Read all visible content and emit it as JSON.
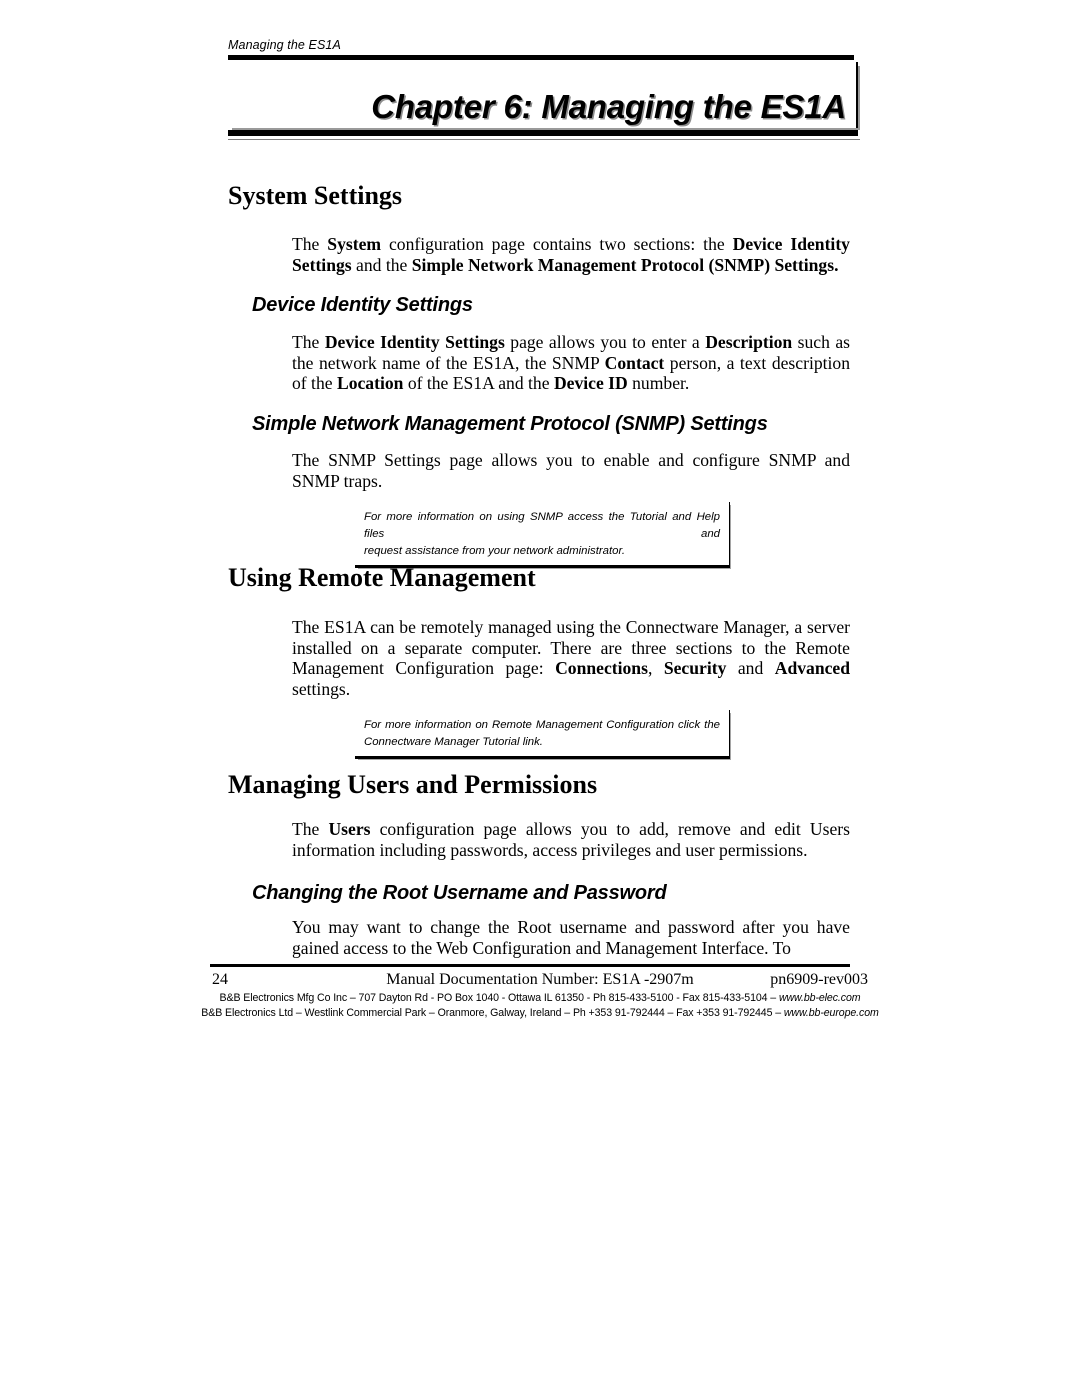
{
  "document": {
    "running_header": "Managing the ES1A",
    "chapter_title": "Chapter 6:  Managing the ES1A"
  },
  "sections": [
    {
      "heading": "System Settings",
      "paragraph_parts": [
        {
          "text": "The ",
          "bold": false
        },
        {
          "text": "System",
          "bold": true
        },
        {
          "text": " configuration page contains two sections: the ",
          "bold": false
        },
        {
          "text": "Device Identity Settings",
          "bold": true
        },
        {
          "text": " and the ",
          "bold": false
        },
        {
          "text": "Simple Network Management Protocol (SNMP) Settings.",
          "bold": true
        }
      ],
      "paragraph_plain": "The System configuration page contains two sections: the Device Identity Settings and the Simple Network Management Protocol (SNMP) Settings."
    },
    {
      "heading": "Device Identity Settings",
      "paragraph_plain": "The Device Identity Settings page allows you to enter a Description such as the network name of the ES1A, the SNMP Contact person, a text description of the Location of the ES1A and the Device ID number."
    },
    {
      "heading": "Simple Network Management Protocol (SNMP) Settings",
      "paragraph_plain": "The SNMP Settings page allows you to enable and configure SNMP and SNMP traps."
    },
    {
      "heading": "Using Remote Management",
      "paragraph_plain": "The ES1A can be remotely managed using the Connectware Manager, a server installed on a separate computer. There are three sections to the Remote Management Configuration page: Connections, Security and Advanced settings."
    },
    {
      "heading": "Managing Users and Permissions",
      "paragraph_plain": "The Users configuration page allows you to add, remove and edit Users information including passwords, access privileges and user permissions."
    },
    {
      "heading": "Changing the Root Username and Password",
      "paragraph_plain": "You may want to change the Root username and password after you have gained access to the Web Configuration and Management Interface. To"
    }
  ],
  "notes": [
    {
      "line1": "For more information on using SNMP access the Tutorial and Help files and",
      "line2": "request assistance from your network administrator."
    },
    {
      "line1": "For more information on Remote Management Configuration click the",
      "line2": "Connectware Manager Tutorial link."
    }
  ],
  "footer": {
    "page_number": "24",
    "center": "Manual Documentation Number:  ES1A -2907m",
    "right": "pn6909-rev003",
    "address_line1_pre": "B&B Electronics Mfg Co Inc – 707 Dayton Rd - PO Box 1040 - Ottawa IL 61350 - Ph 815-433-5100 - Fax 815-433-5104 – ",
    "address_line1_url": "www.bb-elec.com",
    "address_line2_pre": "B&B Electronics Ltd – Westlink Commercial Park – Oranmore, Galway, Ireland – Ph +353 91-792444 – Fax +353 91-792445 – ",
    "address_line2_url": "www.bb-europe.com"
  },
  "inline": {
    "s1_the": "The ",
    "s1_system": "System",
    "s1_mid": " configuration page contains two sections: the ",
    "s1_dis": "Device Identity Settings",
    "s1_and_the": " and the ",
    "s1_snmp": "Simple Network Management Protocol (SNMP) Settings.",
    "s2_the": "The ",
    "s2_dis": "Device Identity Settings",
    "s2_a": " page allows you to enter a ",
    "s2_desc": "Description",
    "s2_b": " such as the network name of the ES1A, the SNMP ",
    "s2_contact": "Contact",
    "s2_c": " person, a text description of the ",
    "s2_location": "Location",
    "s2_d": " of the ES1A and the ",
    "s2_devid": "Device ID",
    "s2_e": " number.",
    "s3_text": "The SNMP Settings page allows you to enable and configure SNMP and SNMP traps.",
    "s4_a": "The ES1A can be remotely managed using the Connectware Manager, a server installed on a separate computer. There are three sections to the Remote Management Configuration page: ",
    "s4_connections": "Connections",
    "s4_comma": ", ",
    "s4_security": "Security",
    "s4_and": " and ",
    "s4_advanced": "Advanced",
    "s4_end": " settings.",
    "s5_the": "The ",
    "s5_users": "Users",
    "s5_rest": " configuration page allows you to add, remove and edit Users information including passwords, access privileges and user permissions.",
    "s6_text": "You may want to change the Root username and password after you have gained access to the Web Configuration and Management Interface. To"
  },
  "headings": {
    "system_settings": "System Settings",
    "device_identity": "Device Identity Settings",
    "snmp_settings": "Simple Network Management Protocol (SNMP) Settings",
    "using_remote": "Using Remote Management",
    "managing_users": "Managing Users and Permissions",
    "changing_root": "Changing the Root Username and Password"
  }
}
